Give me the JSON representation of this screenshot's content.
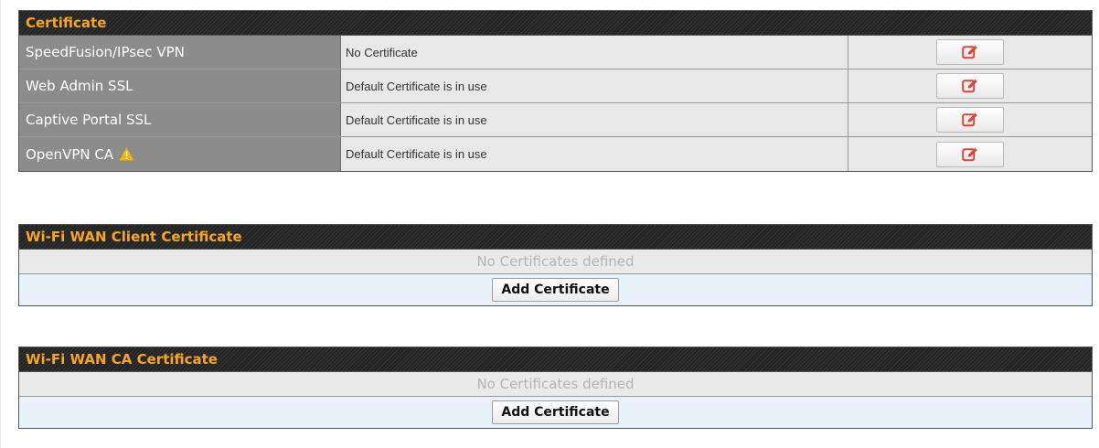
{
  "certificate_section": {
    "title": "Certificate",
    "rows": [
      {
        "label": "SpeedFusion/IPsec VPN",
        "value": "No Certificate",
        "action_icon": "edit-icon",
        "warning": false
      },
      {
        "label": "Web Admin SSL",
        "value": "Default Certificate is in use",
        "action_icon": "edit-icon",
        "warning": false
      },
      {
        "label": "Captive Portal SSL",
        "value": "Default Certificate is in use",
        "action_icon": "edit-icon",
        "warning": false
      },
      {
        "label": "OpenVPN CA",
        "value": "Default Certificate is in use",
        "action_icon": "edit-icon",
        "warning": true
      }
    ]
  },
  "wifi_wan_client_section": {
    "title": "Wi-Fi WAN Client Certificate",
    "empty_text": "No Certificates defined",
    "add_label": "Add Certificate"
  },
  "wifi_wan_ca_section": {
    "title": "Wi-Fi WAN CA Certificate",
    "empty_text": "No Certificates defined",
    "add_label": "Add Certificate"
  },
  "colors": {
    "header_text": "#f5a623",
    "label_bg": "#8c8c8c",
    "edit_icon": "#e0433a",
    "warning_icon": "#f5b400"
  }
}
